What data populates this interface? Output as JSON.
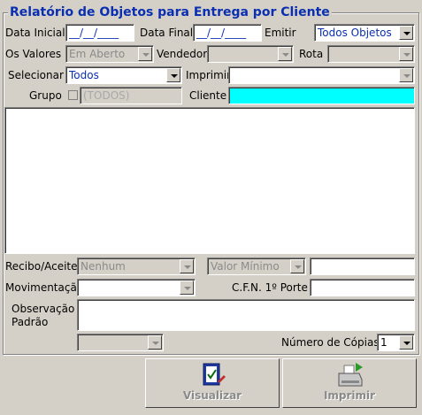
{
  "title": "Relatório de Objetos para Entrega por Cliente",
  "row1": {
    "data_inicial_label": "Data Inicial",
    "data_inicial_value": "__/__/____",
    "data_final_label": "Data Final",
    "data_final_value": "__/__/____",
    "emitir_label": "Emitir",
    "emitir_value": "Todos Objetos"
  },
  "row2": {
    "os_valores_label": "Os Valores",
    "os_valores_value": "Em Aberto",
    "vendedor_label": "Vendedor",
    "vendedor_value": "",
    "rota_label": "Rota",
    "rota_value": ""
  },
  "row3": {
    "selecionar_label": "Selecionar",
    "selecionar_value": "Todos",
    "imprimir_label": "Imprimir",
    "imprimir_value": ""
  },
  "row4": {
    "grupo_label": "Grupo",
    "grupo_value": "(TODOS)",
    "cliente_label": "Cliente",
    "cliente_value": ""
  },
  "bottom": {
    "recibo_label": "Recibo/Aceite",
    "recibo_value": "Nenhum",
    "valor_minimo_value": "Valor Mínimo",
    "valor_minimo_input": "",
    "movimentacao_label": "Movimentação",
    "movimentacao_value": "",
    "cfn_label": "C.F.N. 1º Porte",
    "cfn_value": "",
    "observacao_label_1": "Observação",
    "observacao_label_2": "Padrão",
    "observacao_value": "",
    "extra_combo_value": "",
    "copias_label": "Número de Cópias",
    "copias_value": "1"
  },
  "buttons": {
    "visualizar": "Visualizar",
    "imprimir": "Imprimir"
  },
  "colors": {
    "title": "#0a2fb0",
    "cliente_field": "#00ffff",
    "background": "#d4d0c8"
  }
}
